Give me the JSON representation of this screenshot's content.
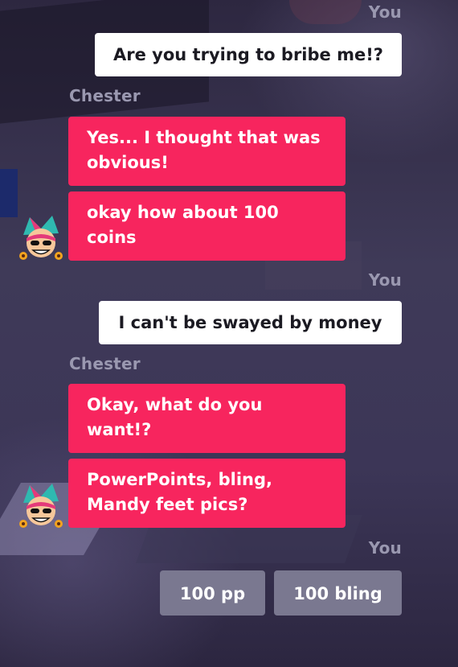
{
  "speakers": {
    "player": "You",
    "npc": "Chester"
  },
  "conversation": {
    "player_1": "Are you trying to bribe me!?",
    "npc_1_line_1": "Yes... I thought that was obvious!",
    "npc_1_line_2": "okay how about 100 coins",
    "player_2": "I can't be swayed by money",
    "npc_2_line_1": "Okay, what do you want!?",
    "npc_2_line_2": "PowerPoints, bling, Mandy feet pics?"
  },
  "choices": {
    "option_1": "100 pp",
    "option_2": "100 bling"
  },
  "colors": {
    "npc_bubble": "#f7255e",
    "player_bubble": "#ffffff",
    "choice_button": "#7a7890",
    "speaker_label": "#9a98b0"
  },
  "icons": {
    "npc_avatar": "jester-face-icon"
  }
}
